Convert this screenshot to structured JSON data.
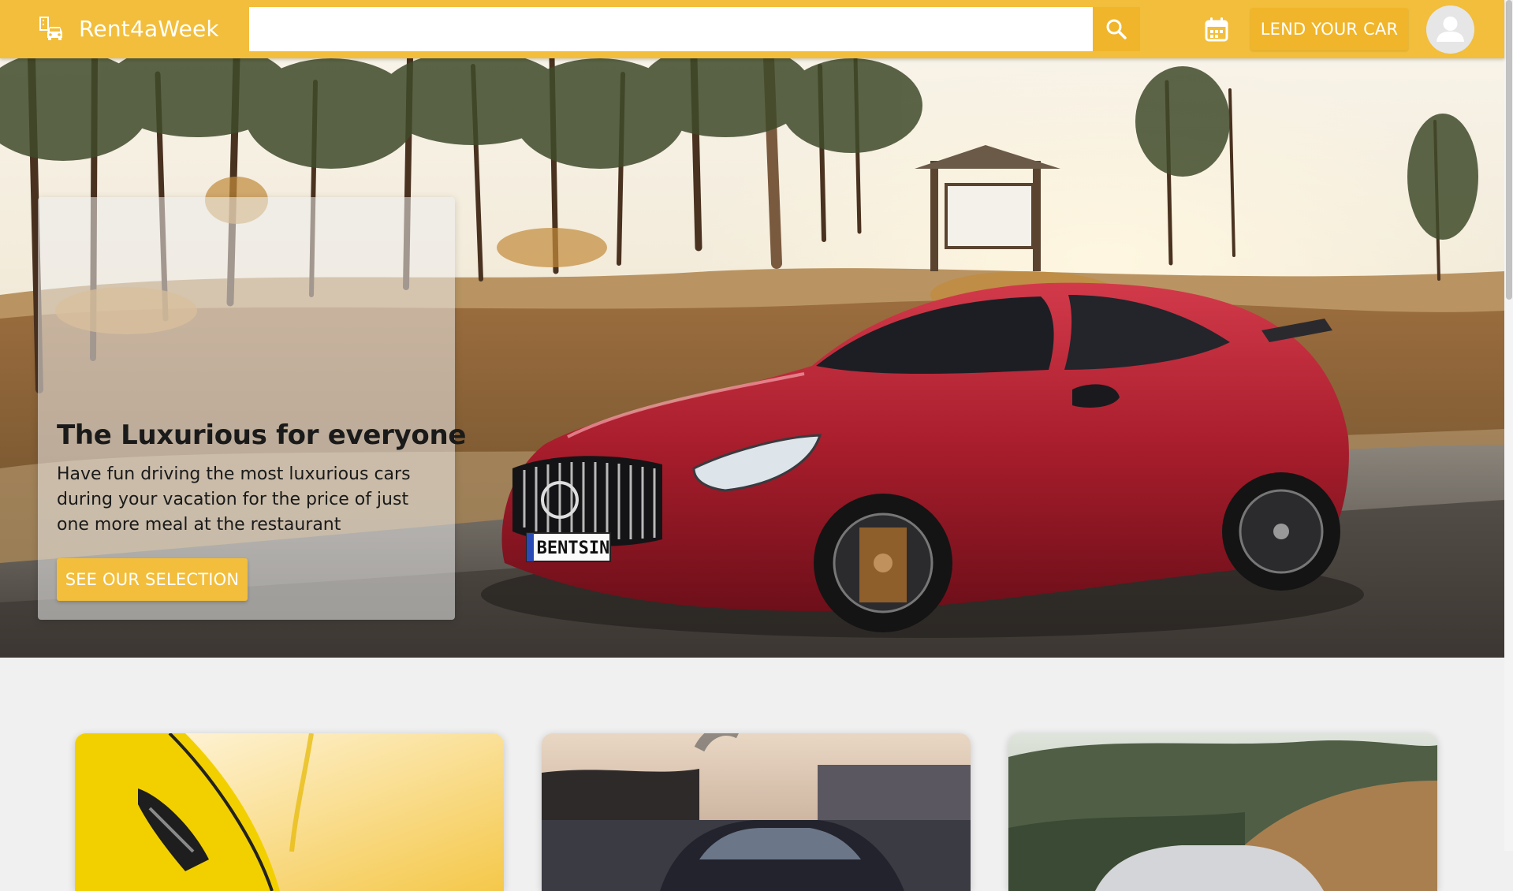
{
  "app": {
    "brand_name": "Rent4aWeek"
  },
  "header": {
    "search_placeholder": "",
    "search_value": "",
    "lend_label": "LEND YOUR CAR"
  },
  "hero": {
    "title": "The Luxurious for everyone",
    "description": "Have fun driving the most luxurious cars during your vacation for the price of just one more meal at the restaurant",
    "cta_label": "SEE OUR SELECTION",
    "plate_text": "BENTSIN"
  },
  "cards": [
    {
      "subject": "yellow-sports-car"
    },
    {
      "subject": "dark-sedan"
    },
    {
      "subject": "silver-car-hills"
    }
  ],
  "theme": {
    "accent": "#f2be3b",
    "accent_dark": "#f0b52a",
    "page_bg": "#f0f0f0"
  },
  "icons": {
    "logo": "car-building-icon",
    "search": "search-icon",
    "calendar": "calendar-icon",
    "avatar": "person-icon"
  }
}
